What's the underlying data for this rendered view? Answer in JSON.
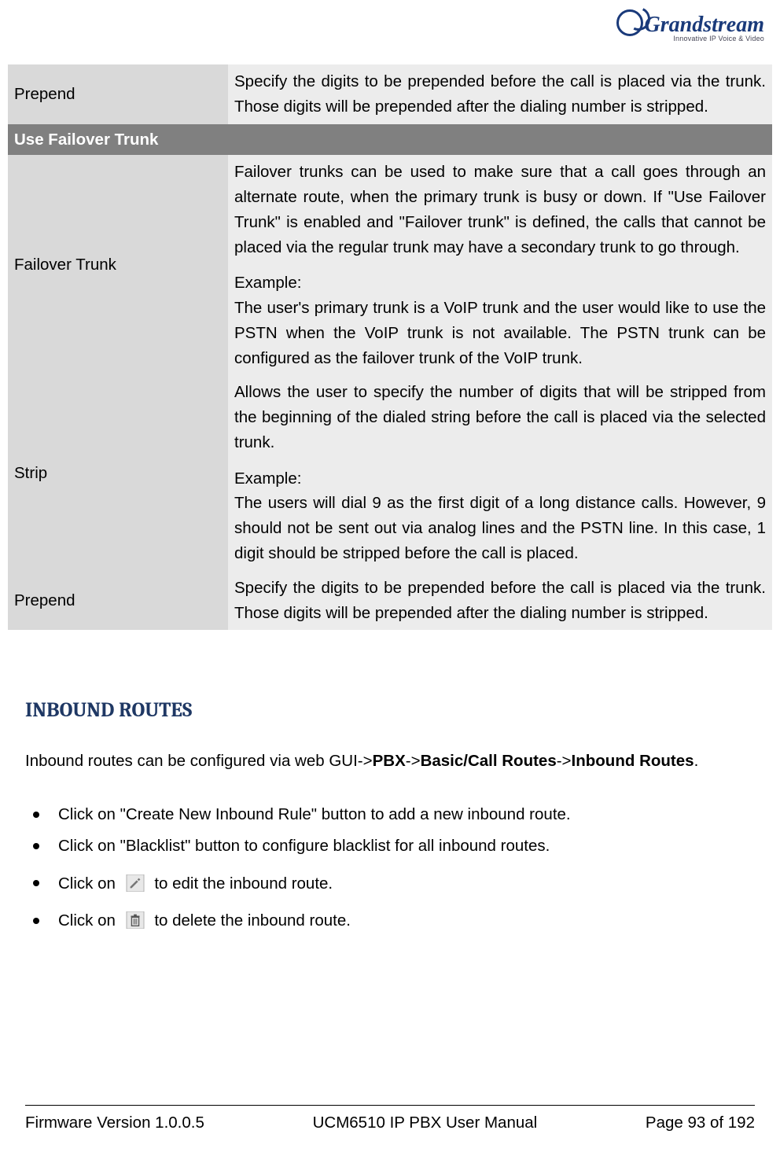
{
  "logo": {
    "brand": "Grandstream",
    "tagline": "Innovative IP Voice & Video"
  },
  "table": {
    "rows": [
      {
        "key": "Prepend",
        "val": "Specify the digits to be prepended before the call is placed via the trunk. Those digits will be prepended after the dialing number is stripped."
      }
    ],
    "section_header": "Use Failover Trunk",
    "rows2": [
      {
        "key": "Failover Trunk",
        "p1": "Failover trunks can be used to make sure that a call goes through an alternate route, when the primary trunk is busy or down. If \"Use Failover Trunk\" is enabled and \"Failover trunk\" is defined, the calls that cannot be placed via the regular trunk may have a secondary trunk to go through.",
        "ex_label": "Example:",
        "p2": "The user's primary trunk is a VoIP trunk and the user would like to use the PSTN when the VoIP trunk is not available. The PSTN trunk can be configured as the failover trunk of the VoIP trunk."
      },
      {
        "key": "Strip",
        "p1": "Allows the user to specify the number of digits that will be stripped from the beginning of the dialed string before the call is placed via the selected trunk.",
        "ex_label": "Example:",
        "p2": "The users will dial 9 as the first digit of a long distance calls. However, 9 should not be sent out via analog lines and the PSTN line. In this case, 1 digit should be stripped before the call is placed."
      },
      {
        "key": "Prepend",
        "p1": "Specify the digits to be prepended before the call is placed via the trunk. Those digits will be prepended after the dialing number is stripped."
      }
    ]
  },
  "section_title": "INBOUND ROUTES",
  "intro": {
    "pre": "Inbound routes can be configured via web GUI->",
    "b1": "PBX",
    "s1": "->",
    "b2": "Basic/Call Routes",
    "s2": "->",
    "b3": "Inbound Routes",
    "post": "."
  },
  "bullets": {
    "b1": "Click on \"Create New Inbound Rule\" button to add a new inbound route.",
    "b2": "Click on \"Blacklist\" button to configure blacklist for all inbound routes.",
    "b3_pre": "Click on ",
    "b3_post": " to edit the inbound route.",
    "b4_pre": "Click on ",
    "b4_post": " to delete the inbound route."
  },
  "footer": {
    "left": "Firmware Version 1.0.0.5",
    "center": "UCM6510 IP PBX User Manual",
    "right": "Page 93 of 192"
  }
}
